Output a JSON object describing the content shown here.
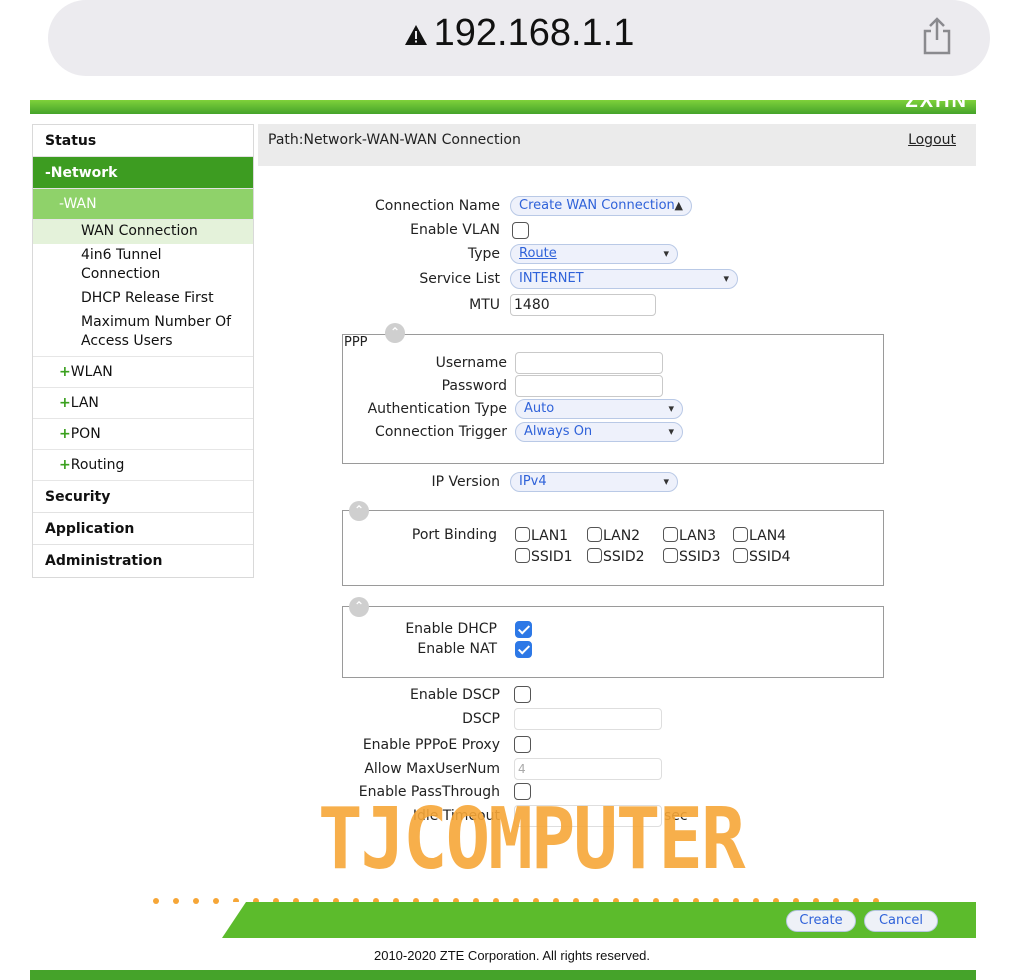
{
  "browser": {
    "url": "192.168.1.1",
    "warning_icon": "warning-triangle-icon",
    "share_icon": "share-icon"
  },
  "brand": "ZXHN",
  "sidebar": {
    "status": "Status",
    "network": "-Network",
    "wan": "-WAN",
    "wan_items": [
      "WAN Connection",
      "4in6 Tunnel Connection",
      "DHCP Release First",
      "Maximum Number Of Access Users"
    ],
    "wlan": "WLAN",
    "lan": "LAN",
    "pon": "PON",
    "routing": "Routing",
    "plus": "+",
    "security": "Security",
    "application": "Application",
    "administration": "Administration"
  },
  "header": {
    "path": "Path:Network-WAN-WAN Connection",
    "logout": "Logout"
  },
  "form": {
    "connection_name_label": "Connection Name",
    "connection_name_value": "Create WAN Connection",
    "enable_vlan_label": "Enable VLAN",
    "enable_vlan": false,
    "type_label": "Type",
    "type_value": "Route",
    "service_list_label": "Service List",
    "service_list_value": "INTERNET",
    "mtu_label": "MTU",
    "mtu_value": "1480",
    "ppp": {
      "legend": "PPP",
      "username_label": "Username",
      "username_value": "",
      "password_label": "Password",
      "password_value": "",
      "auth_type_label": "Authentication Type",
      "auth_type_value": "Auto",
      "conn_trigger_label": "Connection Trigger",
      "conn_trigger_value": "Always On"
    },
    "ip_version_label": "IP Version",
    "ip_version_value": "IPv4",
    "port_binding_label": "Port Binding",
    "ports": [
      "LAN1",
      "LAN2",
      "LAN3",
      "LAN4",
      "SSID1",
      "SSID2",
      "SSID3",
      "SSID4"
    ],
    "enable_dhcp_label": "Enable DHCP",
    "enable_dhcp": true,
    "enable_nat_label": "Enable NAT",
    "enable_nat": true,
    "enable_dscp_label": "Enable DSCP",
    "dscp_label": "DSCP",
    "dscp_value": "",
    "enable_pppoe_proxy_label": "Enable PPPoE Proxy",
    "allow_maxusernum_label": "Allow MaxUserNum",
    "allow_maxusernum_value": "4",
    "enable_passthrough_label": "Enable PassThrough",
    "idle_timeout_label": "Idle Timeout",
    "idle_timeout_unit": "sec"
  },
  "buttons": {
    "create": "Create",
    "cancel": "Cancel"
  },
  "watermark": "TJCOMPUTER",
  "footer": "2010-2020 ZTE Corporation. All rights reserved.",
  "colors": {
    "green": "#3d9c21",
    "light_green": "#8fd26a",
    "link_blue": "#2f62d9",
    "watermark": "#f6a637"
  }
}
